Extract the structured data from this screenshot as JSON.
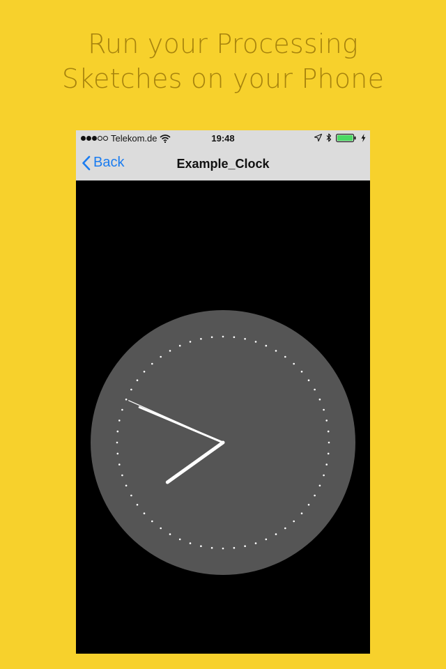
{
  "promo": {
    "line1": "Run your Processing",
    "line2": "Sketches on your Phone"
  },
  "status_bar": {
    "carrier": "Telekom.de",
    "time": "19:48",
    "signal_bars_filled": 3,
    "signal_bars_total": 5,
    "battery_level": 1.0,
    "battery_color": "#4cd964"
  },
  "nav_bar": {
    "back_label": "Back",
    "title": "Example_Clock",
    "accent": "#1a7cf0"
  },
  "clock": {
    "hours": 7,
    "minutes": 48,
    "seconds": 49,
    "face_color": "#555555",
    "hand_color": "#ffffff",
    "tick_count": 60
  },
  "colors": {
    "background": "#f7d12c",
    "promo_text": "#a7830d"
  }
}
